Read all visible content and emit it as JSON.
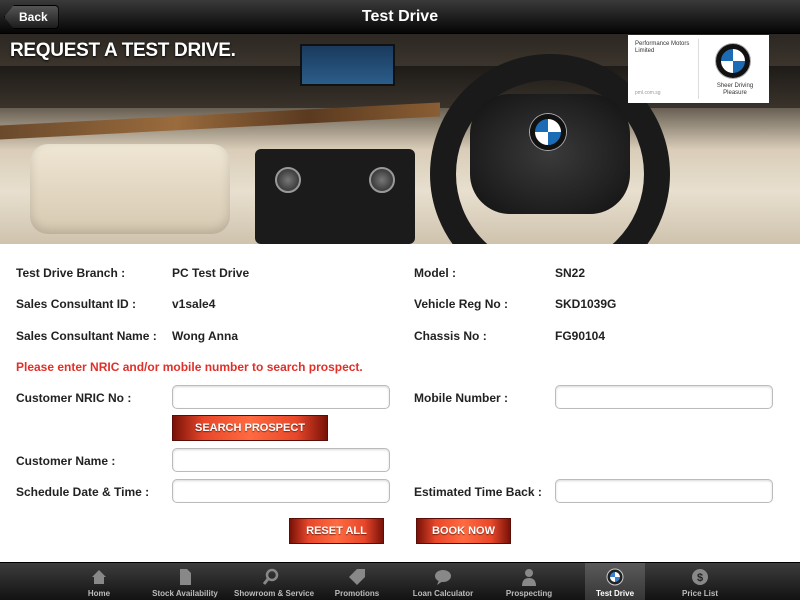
{
  "header": {
    "back_label": "Back",
    "title": "Test Drive"
  },
  "banner": {
    "title": "REQUEST A TEST DRIVE.",
    "dealer_name": "Performance Motors Limited",
    "dealer_url": "pml.com.sg",
    "tagline": "Sheer Driving Pleasure"
  },
  "details": {
    "branch_label": "Test Drive Branch :",
    "branch_value": "PC Test Drive",
    "consultant_id_label": "Sales Consultant ID :",
    "consultant_id_value": "v1sale4",
    "consultant_name_label": "Sales Consultant Name :",
    "consultant_name_value": "Wong Anna",
    "model_label": "Model :",
    "model_value": "SN22",
    "reg_label": "Vehicle Reg No :",
    "reg_value": "SKD1039G",
    "chassis_label": "Chassis No :",
    "chassis_value": "FG90104"
  },
  "form": {
    "warning": "Please enter NRIC and/or mobile number to search prospect.",
    "nric_label": "Customer NRIC No :",
    "nric_value": "",
    "mobile_label": "Mobile Number :",
    "mobile_value": "",
    "search_button": "SEARCH PROSPECT",
    "name_label": "Customer Name :",
    "name_value": "",
    "schedule_label": "Schedule Date & Time :",
    "schedule_value": "",
    "time_back_label": "Estimated Time Back :",
    "time_back_value": "",
    "reset_button": "RESET ALL",
    "book_button": "BOOK NOW"
  },
  "tabs": [
    {
      "label": "Home",
      "icon": "home-icon",
      "active": false
    },
    {
      "label": "Stock Availability",
      "icon": "document-icon",
      "active": false
    },
    {
      "label": "Showroom & Service",
      "icon": "search-icon",
      "active": false
    },
    {
      "label": "Promotions",
      "icon": "tag-icon",
      "active": false
    },
    {
      "label": "Loan Calculator",
      "icon": "chat-bubble-icon",
      "active": false
    },
    {
      "label": "Prospecting",
      "icon": "person-icon",
      "active": false
    },
    {
      "label": "Test Drive",
      "icon": "bmw-roundel-icon",
      "active": true
    },
    {
      "label": "Price List",
      "icon": "dollar-icon",
      "active": false
    }
  ],
  "colors": {
    "accent_red": "#e8472a",
    "warning_red": "#e0302a",
    "bar_dark": "#121212"
  }
}
